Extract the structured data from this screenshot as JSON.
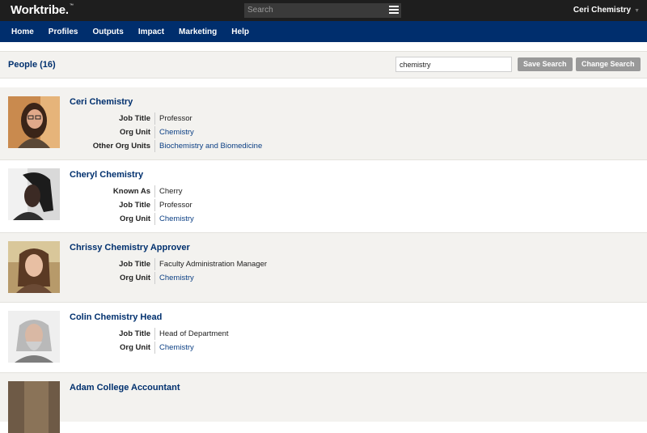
{
  "app": {
    "logo": "Worktribe.",
    "logo_mark": "™",
    "search_placeholder": "Search",
    "user_name": "Ceri Chemistry"
  },
  "nav": [
    "Home",
    "Profiles",
    "Outputs",
    "Impact",
    "Marketing",
    "Help"
  ],
  "toolbar": {
    "title": "People (16)",
    "search_value": "chemistry",
    "save_label": "Save Search",
    "change_label": "Change Search"
  },
  "people": [
    {
      "name": "Ceri Chemistry",
      "fields": [
        {
          "label": "Job Title",
          "value": "Professor"
        },
        {
          "label": "Org Unit",
          "value": "Chemistry"
        },
        {
          "label": "Other Org Units",
          "value": "Biochemistry and Biomedicine"
        }
      ]
    },
    {
      "name": "Cheryl Chemistry",
      "fields": [
        {
          "label": "Known As",
          "value": "Cherry"
        },
        {
          "label": "Job Title",
          "value": "Professor"
        },
        {
          "label": "Org Unit",
          "value": "Chemistry"
        }
      ]
    },
    {
      "name": "Chrissy Chemistry Approver",
      "fields": [
        {
          "label": "Job Title",
          "value": "Faculty Administration Manager"
        },
        {
          "label": "Org Unit",
          "value": "Chemistry"
        }
      ]
    },
    {
      "name": "Colin Chemistry Head",
      "fields": [
        {
          "label": "Job Title",
          "value": "Head of Department"
        },
        {
          "label": "Org Unit",
          "value": "Chemistry"
        }
      ]
    },
    {
      "name": "Adam College Accountant",
      "fields": []
    }
  ]
}
